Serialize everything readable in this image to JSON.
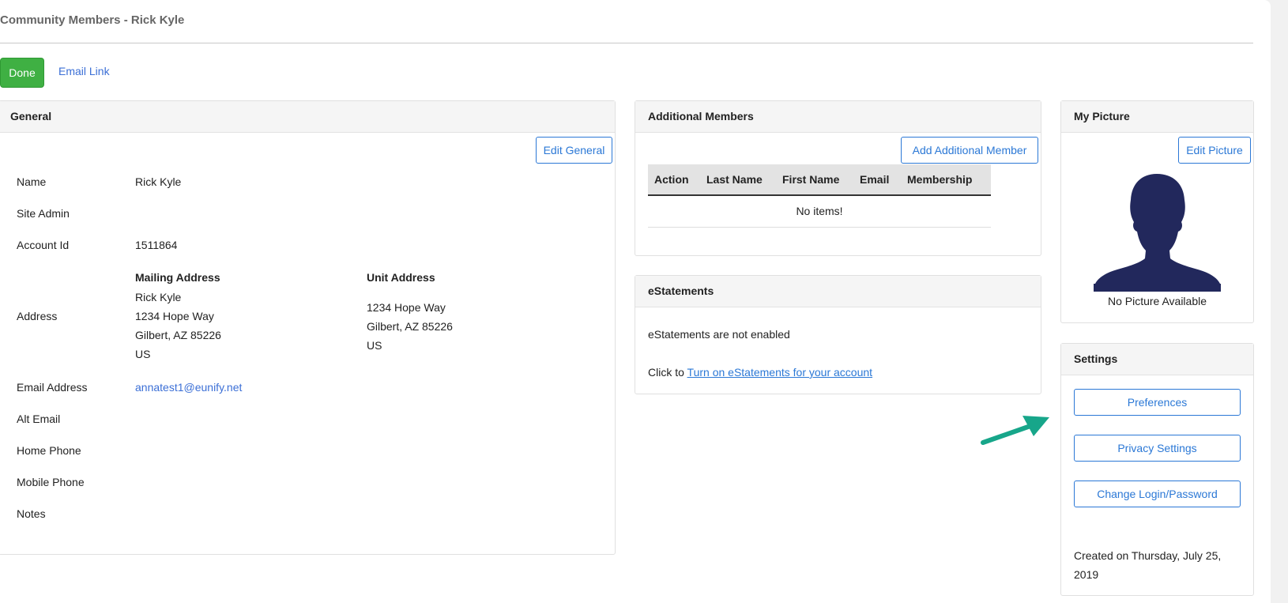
{
  "header": {
    "title": "Community Members - Rick Kyle",
    "done_label": "Done",
    "email_link_label": "Email Link"
  },
  "general": {
    "heading": "General",
    "edit_label": "Edit General",
    "fields": {
      "name_label": "Name",
      "name_value": "Rick Kyle",
      "site_admin_label": "Site Admin",
      "account_id_label": "Account Id",
      "account_id_value": "1511864",
      "address_label": "Address",
      "mailing_heading": "Mailing Address",
      "mailing_lines": [
        "Rick Kyle",
        "1234 Hope Way",
        "Gilbert, AZ 85226",
        "US"
      ],
      "unit_heading": "Unit Address",
      "unit_lines": [
        "1234 Hope Way",
        "Gilbert, AZ 85226",
        "US"
      ],
      "email_label": "Email Address",
      "email_value": "annatest1@eunify.net",
      "alt_email_label": "Alt Email",
      "home_phone_label": "Home Phone",
      "mobile_phone_label": "Mobile Phone",
      "notes_label": "Notes"
    }
  },
  "additional_members": {
    "heading": "Additional Members",
    "add_label": "Add Additional Member",
    "columns": [
      "Action",
      "Last Name",
      "First Name",
      "Email",
      "Membership"
    ],
    "empty_text": "No items!"
  },
  "estatements": {
    "heading": "eStatements",
    "status_text": "eStatements are not enabled",
    "prompt_text": "Click to",
    "link_text": "Turn on eStatements for your account"
  },
  "picture": {
    "heading": "My Picture",
    "edit_label": "Edit Picture",
    "caption": "No Picture Available"
  },
  "settings": {
    "heading": "Settings",
    "preferences_label": "Preferences",
    "privacy_label": "Privacy Settings",
    "change_login_label": "Change Login/Password",
    "created_text": "Created on Thursday, July 25, 2019"
  },
  "colors": {
    "accent": "#2b78d6",
    "done_green": "#3fb043",
    "arrow_teal": "#17a68a",
    "silhouette": "#22285c"
  }
}
